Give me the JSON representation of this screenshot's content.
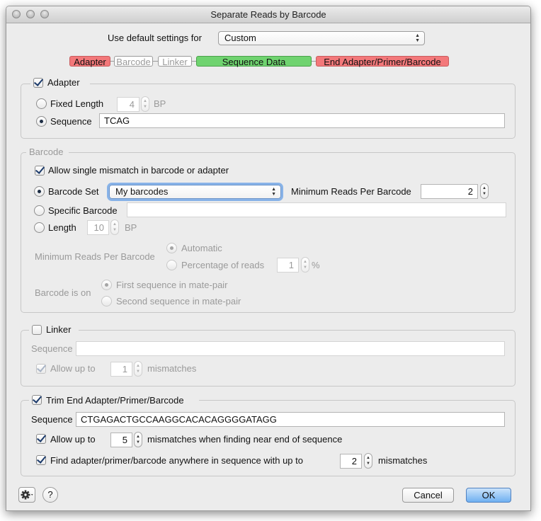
{
  "window": {
    "title": "Separate Reads by Barcode"
  },
  "defaults": {
    "label": "Use default settings for",
    "value": "Custom"
  },
  "segments": [
    {
      "label": "Adapter",
      "color": "#f3787a"
    },
    {
      "label": "Barcode",
      "color": "#ffffff"
    },
    {
      "label": "Linker",
      "color": "#ffffff"
    },
    {
      "label": "Sequence Data",
      "color": "#6fd36f"
    },
    {
      "label": "End Adapter/Primer/Barcode",
      "color": "#f3787a"
    }
  ],
  "adapter": {
    "title": "Adapter",
    "fixed_length_label": "Fixed Length",
    "fixed_length_value": "4",
    "fixed_length_unit": "BP",
    "sequence_label": "Sequence",
    "sequence_value": "TCAG"
  },
  "barcode": {
    "title": "Barcode",
    "allow_mismatch_label": "Allow single mismatch in barcode or adapter",
    "barcode_set_label": "Barcode Set",
    "barcode_set_value": "My barcodes",
    "min_reads_label": "Minimum Reads Per Barcode",
    "min_reads_value": "2",
    "specific_label": "Specific Barcode",
    "specific_value": "",
    "length_label": "Length",
    "length_value": "10",
    "length_unit": "BP",
    "min_reads_group_label": "Minimum Reads Per Barcode",
    "automatic_label": "Automatic",
    "percentage_label": "Percentage of reads",
    "percentage_value": "1",
    "percentage_unit": "%",
    "barcode_on_label": "Barcode is on",
    "first_seq_label": "First sequence in mate-pair",
    "second_seq_label": "Second sequence in mate-pair"
  },
  "linker": {
    "title": "Linker",
    "sequence_label": "Sequence",
    "sequence_value": "",
    "allow_label": "Allow up to",
    "allow_value": "1",
    "mismatches_label": "mismatches"
  },
  "trim": {
    "title": "Trim End Adapter/Primer/Barcode",
    "sequence_label": "Sequence",
    "sequence_value": "CTGAGACTGCCAAGGCACACAGGGGATAGG",
    "allow_label": "Allow up to",
    "allow_value": "5",
    "allow_suffix": "mismatches when finding near end of sequence",
    "find_label": "Find adapter/primer/barcode anywhere in sequence with up to",
    "find_value": "2",
    "find_suffix": "mismatches"
  },
  "footer": {
    "cancel_label": "Cancel",
    "ok_label": "OK",
    "help_label": "?",
    "gear_icon": "gear-icon"
  }
}
